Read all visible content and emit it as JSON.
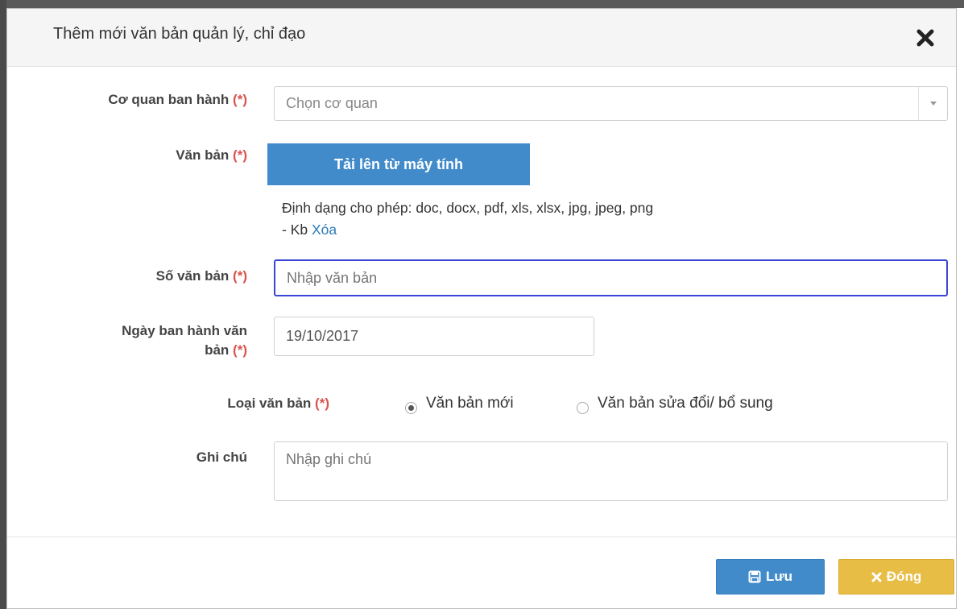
{
  "modal": {
    "title": "Thêm mới văn bản quản lý, chỉ đạo"
  },
  "form": {
    "agency": {
      "label": "Cơ quan ban hành",
      "required_mark": "(*)",
      "placeholder": "Chọn cơ quan"
    },
    "document": {
      "label": "Văn bản",
      "required_mark": "(*)",
      "upload_label": "Tải lên từ máy tính",
      "hint_formats": "Định dạng cho phép: doc, docx, pdf, xls, xlsx, jpg, jpeg, png",
      "hint_size": "- Kb",
      "delete_link": "Xóa"
    },
    "number": {
      "label": "Số văn bản",
      "required_mark": "(*)",
      "placeholder": "Nhập văn bản",
      "value": ""
    },
    "date": {
      "label_line1": "Ngày ban hành văn",
      "label_line2": "bản",
      "required_mark": "(*)",
      "value": "19/10/2017"
    },
    "type": {
      "label": "Loại văn bản",
      "required_mark": "(*)",
      "options": [
        {
          "label": "Văn bản mới",
          "checked": true
        },
        {
          "label": "Văn bản sửa đổi/ bổ sung",
          "checked": false
        }
      ]
    },
    "note": {
      "label": "Ghi chú",
      "placeholder": "Nhập ghi chú"
    }
  },
  "footer": {
    "save_label": "Lưu",
    "close_label": "Đóng"
  },
  "icons": {
    "close": "close-icon",
    "save": "floppy-disk-icon",
    "dismiss": "x-icon"
  },
  "colors": {
    "primary": "#428bca",
    "warning": "#e8bd45",
    "required": "#d9534f",
    "focus": "#3b46d6",
    "link": "#2a7ab8"
  }
}
